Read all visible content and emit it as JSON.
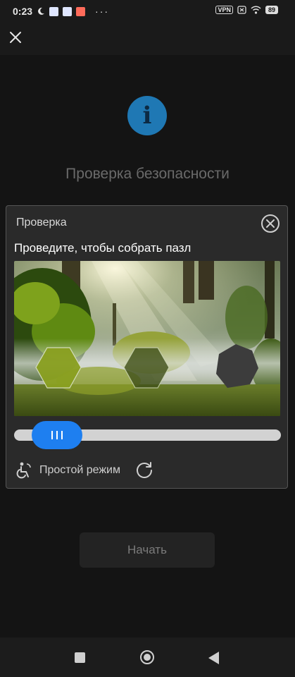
{
  "status_bar": {
    "time": "0:23",
    "vpn": "VPN",
    "battery": "89",
    "overflow": "···"
  },
  "top_bar": {
    "close_icon": "close-icon"
  },
  "page": {
    "info_icon_glyph": "i",
    "title": "Проверка безопасности",
    "start_button": "Начать"
  },
  "modal": {
    "title": "Проверка",
    "instruction": "Проведите, чтобы собрать пазл",
    "slider_progress": 0.06,
    "simple_mode": "Простой режим"
  },
  "colors": {
    "accent": "#1e7ff0",
    "info_circle": "#1f78b4"
  }
}
